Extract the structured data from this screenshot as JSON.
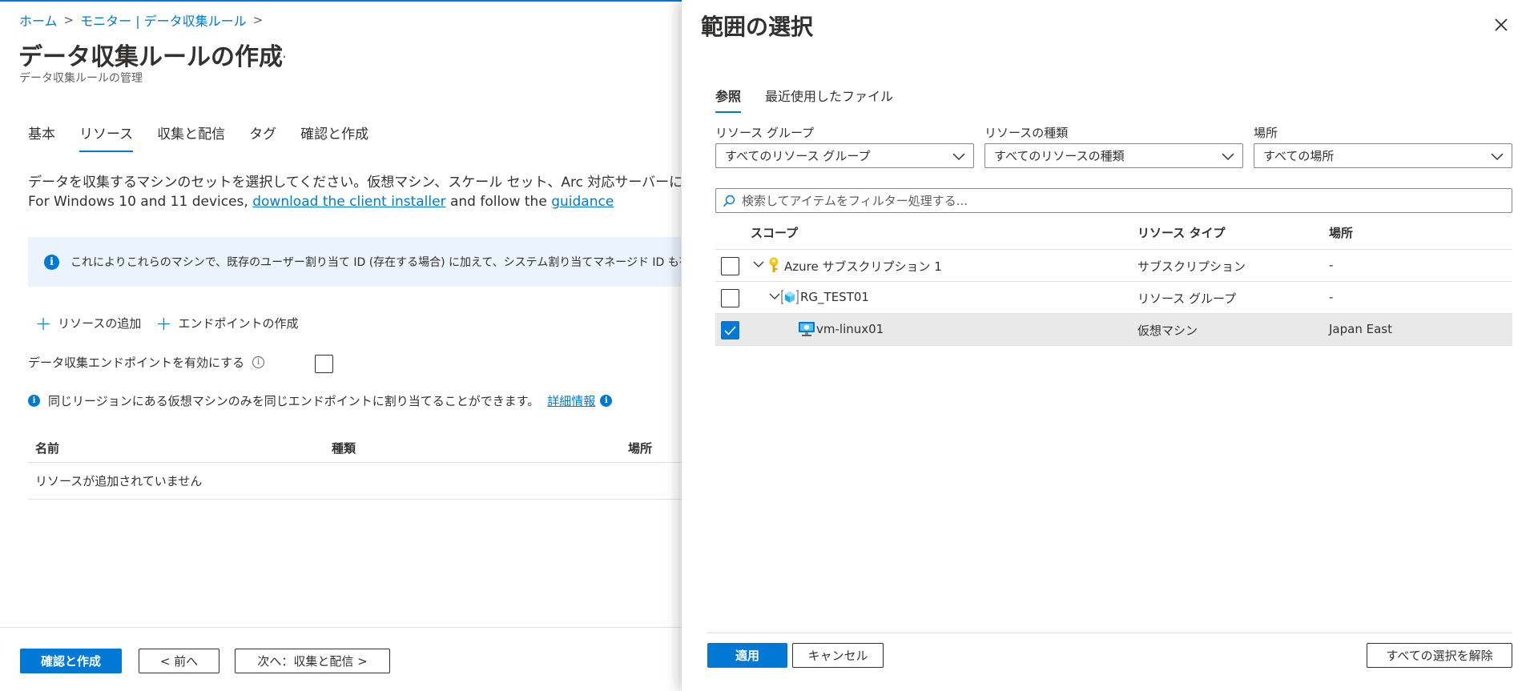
{
  "breadcrumb": {
    "items": [
      "ホーム",
      "モニター | データ収集ルール"
    ]
  },
  "page": {
    "title": "データ収集ルールの作成",
    "more": "…",
    "subtitle": "データ収集ルールの管理"
  },
  "tabs": [
    "基本",
    "リソース",
    "収集と配信",
    "タグ",
    "確認と作成"
  ],
  "active_tab": "リソース",
  "description": {
    "line1": "データを収集するマシンのセットを選択してください。仮想マシン、スケール セット、Arc 対応サーバーには、Azure Monito",
    "line2_prefix": "For Windows 10 and 11 devices, ",
    "line2_link1": "download the client installer",
    "line2_mid": " and follow the ",
    "line2_link2": "guidance"
  },
  "info_banner": "これによりこれらのマシンで、既存のユーザー割り当て ID (存在する場合) に加えて、システム割り当てマネージド ID も有効になりま",
  "actions": {
    "add_resource": "リソースの追加",
    "create_endpoint": "エンドポイントの作成"
  },
  "endpoint": {
    "label": "データ収集エンドポイントを有効にする",
    "checked": false
  },
  "region_note": {
    "text": "同じリージョンにある仮想マシンのみを同じエンドポイントに割り当てることができます。",
    "link": "詳細情報"
  },
  "resource_table": {
    "columns": [
      "名前",
      "種類",
      "場所"
    ],
    "empty_text": "リソースが追加されていません"
  },
  "footer": {
    "review_create": "確認と作成",
    "prev": "< 前へ",
    "next": "次へ：収集と配信 >"
  },
  "panel": {
    "title": "範囲の選択",
    "tabs": [
      "参照",
      "最近使用したファイル"
    ],
    "active_tab": "参照",
    "filters": {
      "resource_group": {
        "label": "リソース グループ",
        "value": "すべてのリソース グループ"
      },
      "resource_type": {
        "label": "リソースの種類",
        "value": "すべてのリソースの種類"
      },
      "location": {
        "label": "場所",
        "value": "すべての場所"
      }
    },
    "search_placeholder": "検索してアイテムをフィルター処理する...",
    "grid": {
      "columns": [
        "スコープ",
        "リソース タイプ",
        "場所"
      ],
      "rows": [
        {
          "name": "Azure サブスクリプション 1",
          "type": "サブスクリプション",
          "location": "-",
          "checked": false,
          "icon": "key-icon"
        },
        {
          "name": "RG_TEST01",
          "type": "リソース グループ",
          "location": "-",
          "checked": false,
          "icon": "resource-group-icon"
        },
        {
          "name": "vm-linux01",
          "type": "仮想マシン",
          "location": "Japan East",
          "checked": true,
          "icon": "virtual-machine-icon"
        }
      ]
    },
    "footer": {
      "apply": "適用",
      "cancel": "キャンセル",
      "clear_all": "すべての選択を解除"
    }
  },
  "colors": {
    "accent": "#0078d4",
    "info_bg": "#ebf3fc",
    "selected_row": "#e9e9e9"
  }
}
